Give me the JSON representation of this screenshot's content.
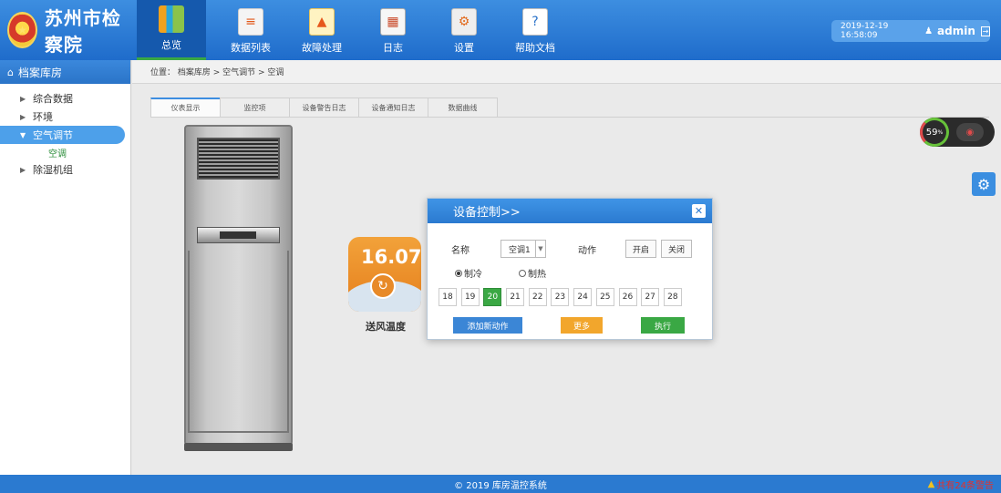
{
  "header": {
    "site_title": "苏州市检察院",
    "nav": [
      {
        "label": "总览",
        "icon": "books-icon"
      },
      {
        "label": "数据列表",
        "icon": "list-icon"
      },
      {
        "label": "故障处理",
        "icon": "warning-icon"
      },
      {
        "label": "日志",
        "icon": "calendar-icon"
      },
      {
        "label": "设置",
        "icon": "gear-icon"
      },
      {
        "label": "帮助文档",
        "icon": "help-doc-icon"
      }
    ],
    "datetime": "2019-12-19 16:58:09",
    "username": "admin"
  },
  "sidebar": {
    "title": "档案库房",
    "items": [
      {
        "label": "综合数据"
      },
      {
        "label": "环境"
      },
      {
        "label": "空气调节"
      },
      {
        "label": "除湿机组"
      }
    ],
    "sub_item": "空调"
  },
  "breadcrumb": "位置： 档案库房 > 空气调节 > 空调",
  "tabs": [
    "仪表显示",
    "监控项",
    "设备警告日志",
    "设备通知日志",
    "数据曲线"
  ],
  "temperature": {
    "value": "16.07",
    "label": "送风温度"
  },
  "humidity_widget": {
    "value": "59",
    "unit": "%"
  },
  "modal": {
    "title": "设备控制>>",
    "name_label": "名称",
    "device_value": "空调1",
    "action_label": "动作",
    "on_label": "开启",
    "off_label": "关闭",
    "mode_cool": "制冷",
    "mode_heat": "制热",
    "temps": [
      "18",
      "19",
      "20",
      "21",
      "22",
      "23",
      "24",
      "25",
      "26",
      "27",
      "28"
    ],
    "selected_temp": "20",
    "add_label": "添加新动作",
    "more_label": "更多",
    "exec_label": "执行"
  },
  "footer": {
    "copyright": "© 2019  库房温控系统",
    "warning": "共有24条警告"
  },
  "colors": {
    "accent": "#2b7ad0",
    "success": "#3aa844",
    "warning": "#f2a62c"
  }
}
